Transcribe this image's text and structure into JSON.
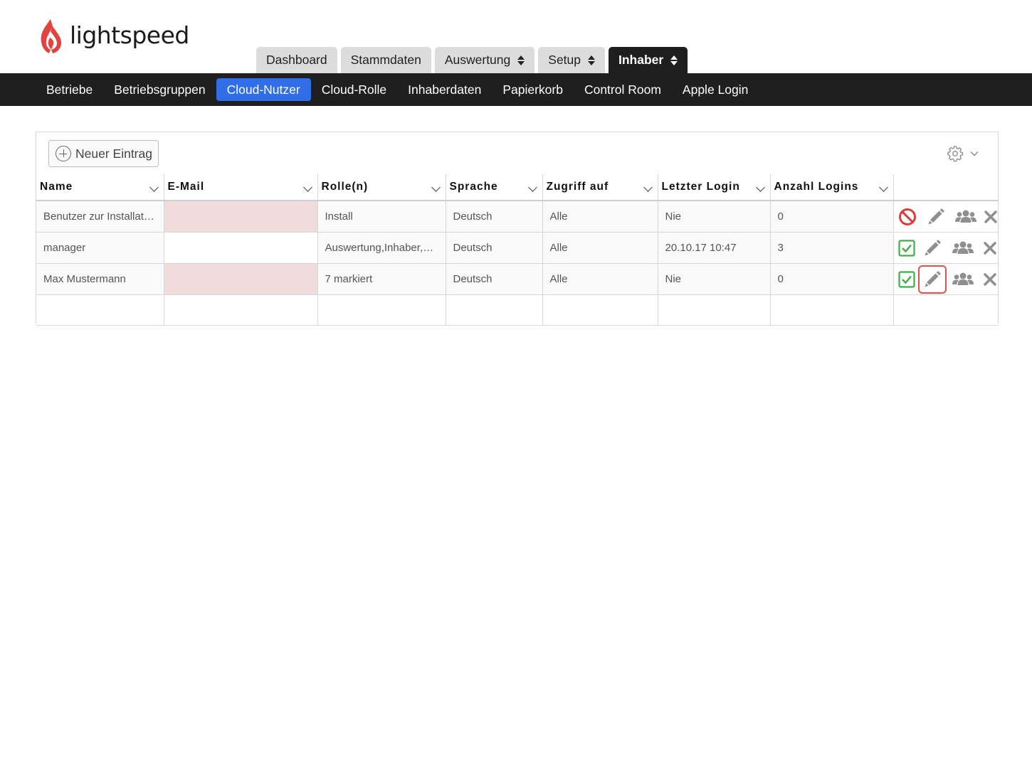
{
  "brand": {
    "name": "lightspeed",
    "accent": "#e0443f"
  },
  "main_tabs": [
    {
      "label": "Dashboard",
      "has_caret": false,
      "active": false
    },
    {
      "label": "Stammdaten",
      "has_caret": false,
      "active": false
    },
    {
      "label": "Auswertung",
      "has_caret": true,
      "active": false
    },
    {
      "label": "Setup",
      "has_caret": true,
      "active": false
    },
    {
      "label": "Inhaber",
      "has_caret": true,
      "active": true
    }
  ],
  "sub_nav": [
    {
      "label": "Betriebe",
      "active": false
    },
    {
      "label": "Betriebsgruppen",
      "active": false
    },
    {
      "label": "Cloud-Nutzer",
      "active": true
    },
    {
      "label": "Cloud-Rolle",
      "active": false
    },
    {
      "label": "Inhaberdaten",
      "active": false
    },
    {
      "label": "Papierkorb",
      "active": false
    },
    {
      "label": "Control Room",
      "active": false
    },
    {
      "label": "Apple Login",
      "active": false
    }
  ],
  "toolbar": {
    "new_entry_label": "Neuer Eintrag",
    "settings_icon": "gear-icon"
  },
  "table": {
    "columns": [
      "Name",
      "E-Mail",
      "Rolle(n)",
      "Sprache",
      "Zugriff auf",
      "Letzter Login",
      "Anzahl Logins"
    ],
    "rows": [
      {
        "name": "Benutzer zur Installat…",
        "email": "",
        "email_missing": true,
        "roles": "Install",
        "language": "Deutsch",
        "access": "Alle",
        "last_login": "Nie",
        "login_count": "0",
        "status": "blocked",
        "edit_highlighted": false
      },
      {
        "name": "manager",
        "email": "",
        "email_missing": false,
        "roles": "Auswertung,Inhaber,…",
        "language": "Deutsch",
        "access": "Alle",
        "last_login": "20.10.17 10:47",
        "login_count": "3",
        "status": "active",
        "edit_highlighted": false
      },
      {
        "name": "Max Mustermann",
        "email": "",
        "email_missing": true,
        "roles": "7 markiert",
        "language": "Deutsch",
        "access": "Alle",
        "last_login": "Nie",
        "login_count": "0",
        "status": "active",
        "edit_highlighted": true
      }
    ]
  },
  "colors": {
    "highlight": "#e05151",
    "active_green": "#3fae49",
    "blocked_red": "#e03b3b",
    "nav_blue": "#2f6ee6"
  }
}
